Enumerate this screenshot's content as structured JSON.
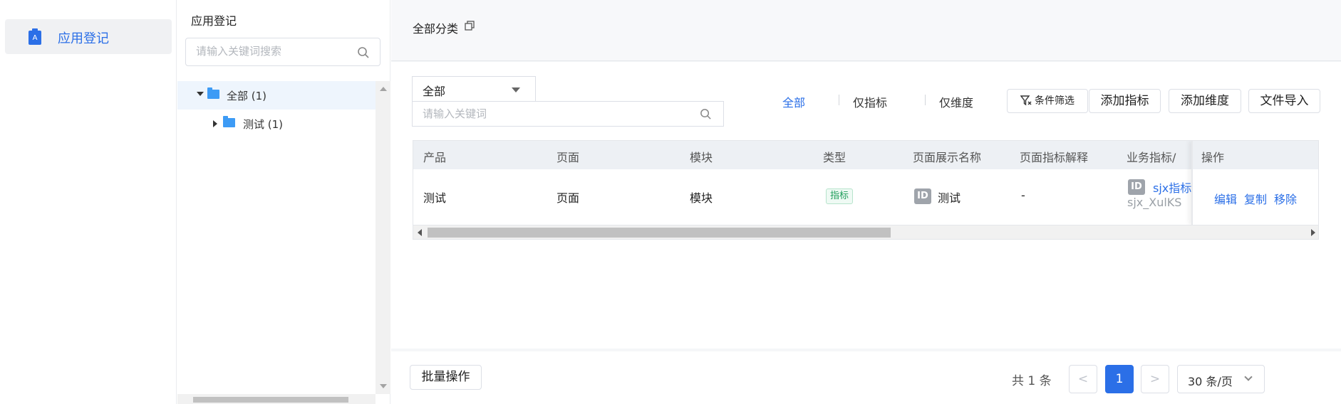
{
  "nav": {
    "items": [
      {
        "label": "应用登记",
        "icon": "app-register-icon"
      }
    ]
  },
  "tree": {
    "title": "应用登记",
    "search_placeholder": "请输入关键词搜索",
    "nodes": [
      {
        "label": "全部 (1)",
        "expanded": true,
        "selected": true
      },
      {
        "label": "测试 (1)",
        "expanded": false,
        "selected": false
      }
    ]
  },
  "topbar": {
    "breadcrumb": "全部分类"
  },
  "filters": {
    "select_value": "全部",
    "keyword_placeholder": "请输入关键词",
    "tabs": [
      "全部",
      "仅指标",
      "仅维度"
    ],
    "active_tab": "全部"
  },
  "actions": {
    "filter_label": "条件筛选",
    "add_metric": "添加指标",
    "add_dimension": "添加维度",
    "import": "文件导入"
  },
  "table": {
    "headers": [
      "产品",
      "页面",
      "模块",
      "类型",
      "页面展示名称",
      "页面指标解释",
      "业务指标/",
      "操作"
    ],
    "rows": [
      {
        "product": "测试",
        "page": "页面",
        "module": "模块",
        "type": "指标",
        "display_badge": "ID",
        "display_name": "测试",
        "explanation": "-",
        "biz_badge": "ID",
        "biz_name": "sjx指标",
        "biz_code": "sjx_XulKS",
        "ops": [
          "编辑",
          "复制",
          "移除"
        ]
      }
    ]
  },
  "footer": {
    "batch": "批量操作",
    "total": "共 1 条",
    "prev": "<",
    "page": "1",
    "next": ">",
    "page_size": "30 条/页"
  },
  "colors": {
    "accent": "#2b6fe7",
    "tag_green": "#1f9d5a",
    "header_bg": "#edf0f4"
  }
}
